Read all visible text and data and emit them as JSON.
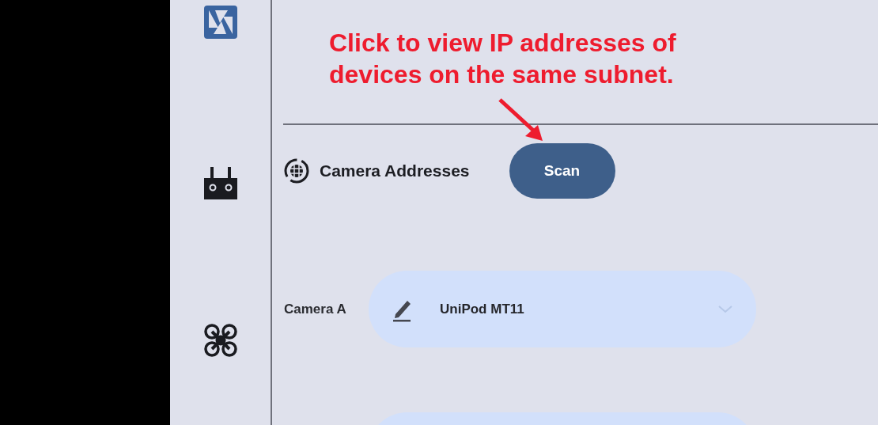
{
  "annotation": {
    "lines": [
      "Click to view IP addresses of",
      "devices on the same subnet."
    ]
  },
  "sidebar": {
    "items": [
      {
        "kind": "aperture",
        "selected": true
      },
      {
        "kind": "remote",
        "selected": false
      },
      {
        "kind": "drone",
        "selected": false
      }
    ]
  },
  "section": {
    "title": "Camera Addresses",
    "button": "Scan"
  },
  "cameras": [
    {
      "kind": "dropdown",
      "label": "Camera A",
      "value": "UniPod MT11"
    },
    {
      "kind": "dropdown"
    }
  ]
}
